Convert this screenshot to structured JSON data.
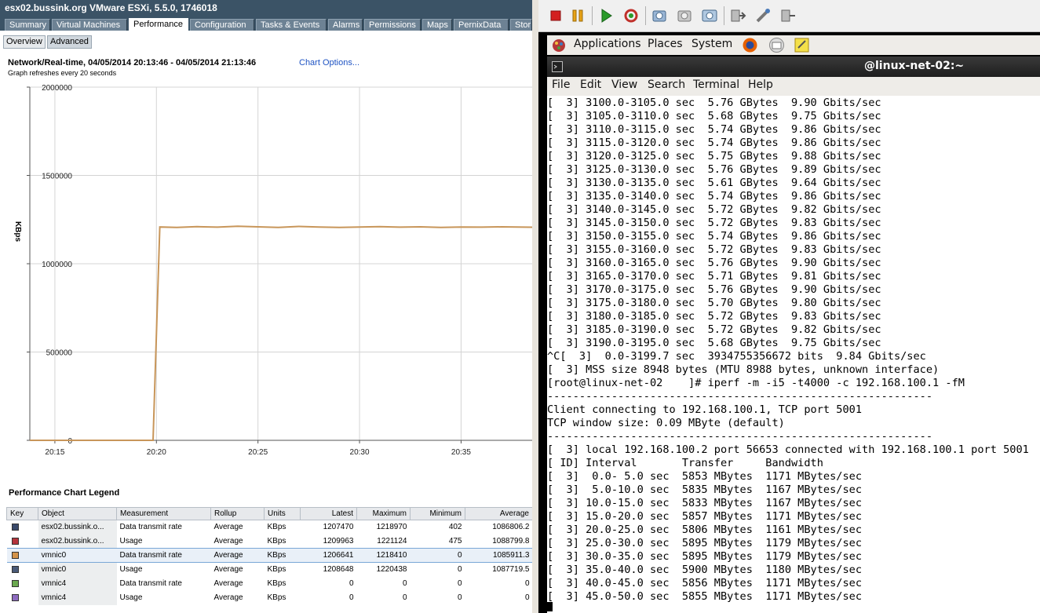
{
  "vsphere": {
    "title": "esx02.bussink.org VMware ESXi, 5.5.0, 1746018",
    "tabs": [
      {
        "label": "Summary"
      },
      {
        "label": "Virtual Machines"
      },
      {
        "label": "Performance"
      },
      {
        "label": "Configuration"
      },
      {
        "label": "Tasks & Events"
      },
      {
        "label": "Alarms"
      },
      {
        "label": "Permissions"
      },
      {
        "label": "Maps"
      },
      {
        "label": "PernixData"
      },
      {
        "label": "Stor"
      }
    ],
    "active_tab": "Performance",
    "subtabs": [
      {
        "label": "Overview"
      },
      {
        "label": "Advanced"
      }
    ],
    "active_subtab": "Advanced",
    "chart_title": "Network/Real-time, 04/05/2014 20:13:46 - 04/05/2014 21:13:46",
    "chart_options_link": "Chart Options...",
    "refresh_note": "Graph refreshes every 20 seconds",
    "legend_title": "Performance Chart Legend",
    "legend_columns": [
      "Key",
      "Object",
      "Measurement",
      "Rollup",
      "Units",
      "Latest",
      "Maximum",
      "Minimum",
      "Average"
    ],
    "legend_rows": [
      {
        "color": "#3a4a6b",
        "object": "esx02.bussink.o...",
        "measurement": "Data transmit rate",
        "rollup": "Average",
        "units": "KBps",
        "latest": "1207470",
        "maximum": "1218970",
        "minimum": "402",
        "average": "1086806.2"
      },
      {
        "color": "#b5343c",
        "object": "esx02.bussink.o...",
        "measurement": "Usage",
        "rollup": "Average",
        "units": "KBps",
        "latest": "1209963",
        "maximum": "1221124",
        "minimum": "475",
        "average": "1088799.8"
      },
      {
        "color": "#d4934a",
        "object": "vmnic0",
        "measurement": "Data transmit rate",
        "rollup": "Average",
        "units": "KBps",
        "latest": "1206641",
        "maximum": "1218410",
        "minimum": "0",
        "average": "1085911.3",
        "selected": true
      },
      {
        "color": "#4a5a78",
        "object": "vmnic0",
        "measurement": "Usage",
        "rollup": "Average",
        "units": "KBps",
        "latest": "1208648",
        "maximum": "1220438",
        "minimum": "0",
        "average": "1087719.5"
      },
      {
        "color": "#6aa84f",
        "object": "vmnic4",
        "measurement": "Data transmit rate",
        "rollup": "Average",
        "units": "KBps",
        "latest": "0",
        "maximum": "0",
        "minimum": "0",
        "average": "0"
      },
      {
        "color": "#8e6cc0",
        "object": "vmnic4",
        "measurement": "Usage",
        "rollup": "Average",
        "units": "KBps",
        "latest": "0",
        "maximum": "0",
        "minimum": "0",
        "average": "0"
      }
    ]
  },
  "chart_data": {
    "type": "line",
    "title": "Network/Real-time, 04/05/2014 20:13:46 - 04/05/2014 21:13:46",
    "xlabel": "",
    "ylabel": "KBps",
    "ylim": [
      0,
      2000000
    ],
    "yticks": [
      "2000000",
      "1500000",
      "1000000",
      "500000",
      "0"
    ],
    "xticks": [
      "20:15",
      "20:20",
      "20:25",
      "20:30",
      "20:35"
    ],
    "xlim": [
      "20:13:46",
      "20:38:30"
    ],
    "grid": true,
    "series": [
      {
        "name": "vmnic0 Data transmit rate",
        "color": "#c8965a",
        "x": [
          "20:13:46",
          "20:19:50",
          "20:20:10",
          "20:21:00",
          "20:22:00",
          "20:23:00",
          "20:24:00",
          "20:25:00",
          "20:26:00",
          "20:27:00",
          "20:28:00",
          "20:29:00",
          "20:30:00",
          "20:31:00",
          "20:32:00",
          "20:33:00",
          "20:34:00",
          "20:35:00",
          "20:36:00",
          "20:37:00",
          "20:38:30"
        ],
        "values": [
          0,
          0,
          1208000,
          1206000,
          1210000,
          1207000,
          1212000,
          1209000,
          1206000,
          1211000,
          1208000,
          1206000,
          1208000,
          1210000,
          1207000,
          1209000,
          1206000,
          1208000,
          1207000,
          1209000,
          1206641
        ]
      }
    ]
  },
  "console": {
    "toolbar_icons": [
      "stop-icon",
      "pause-icon",
      "play-icon",
      "reset-icon",
      "snapshot-icon",
      "revert-icon",
      "manage-snapshots-icon",
      "connect-cd-icon",
      "connect-floppy-icon",
      "connect-device-icon"
    ],
    "panel_menus": [
      "Applications",
      "Places",
      "System"
    ],
    "terminal_title": "@linux-net-02:~",
    "terminal_menus": [
      "File",
      "Edit",
      "View",
      "Search",
      "Terminal",
      "Help"
    ],
    "lines": [
      "[  3] 3100.0-3105.0 sec  5.76 GBytes  9.90 Gbits/sec",
      "[  3] 3105.0-3110.0 sec  5.68 GBytes  9.75 Gbits/sec",
      "[  3] 3110.0-3115.0 sec  5.74 GBytes  9.86 Gbits/sec",
      "[  3] 3115.0-3120.0 sec  5.74 GBytes  9.86 Gbits/sec",
      "[  3] 3120.0-3125.0 sec  5.75 GBytes  9.88 Gbits/sec",
      "[  3] 3125.0-3130.0 sec  5.76 GBytes  9.89 Gbits/sec",
      "[  3] 3130.0-3135.0 sec  5.61 GBytes  9.64 Gbits/sec",
      "[  3] 3135.0-3140.0 sec  5.74 GBytes  9.86 Gbits/sec",
      "[  3] 3140.0-3145.0 sec  5.72 GBytes  9.82 Gbits/sec",
      "[  3] 3145.0-3150.0 sec  5.72 GBytes  9.83 Gbits/sec",
      "[  3] 3150.0-3155.0 sec  5.74 GBytes  9.86 Gbits/sec",
      "[  3] 3155.0-3160.0 sec  5.72 GBytes  9.83 Gbits/sec",
      "[  3] 3160.0-3165.0 sec  5.76 GBytes  9.90 Gbits/sec",
      "[  3] 3165.0-3170.0 sec  5.71 GBytes  9.81 Gbits/sec",
      "[  3] 3170.0-3175.0 sec  5.76 GBytes  9.90 Gbits/sec",
      "[  3] 3175.0-3180.0 sec  5.70 GBytes  9.80 Gbits/sec",
      "[  3] 3180.0-3185.0 sec  5.72 GBytes  9.83 Gbits/sec",
      "[  3] 3185.0-3190.0 sec  5.72 GBytes  9.82 Gbits/sec",
      "[  3] 3190.0-3195.0 sec  5.68 GBytes  9.75 Gbits/sec",
      "^C[  3]  0.0-3199.7 sec  3934755356672 bits  9.84 Gbits/sec",
      "[  3] MSS size 8948 bytes (MTU 8988 bytes, unknown interface)",
      "[root@linux-net-02    ]# iperf -m -i5 -t4000 -c 192.168.100.1 -fM",
      "------------------------------------------------------------",
      "Client connecting to 192.168.100.1, TCP port 5001",
      "TCP window size: 0.09 MByte (default)",
      "------------------------------------------------------------",
      "[  3] local 192.168.100.2 port 56653 connected with 192.168.100.1 port 5001",
      "[ ID] Interval       Transfer     Bandwidth",
      "[  3]  0.0- 5.0 sec  5853 MBytes  1171 MBytes/sec",
      "[  3]  5.0-10.0 sec  5835 MBytes  1167 MBytes/sec",
      "[  3] 10.0-15.0 sec  5833 MBytes  1167 MBytes/sec",
      "[  3] 15.0-20.0 sec  5857 MBytes  1171 MBytes/sec",
      "[  3] 20.0-25.0 sec  5806 MBytes  1161 MBytes/sec",
      "[  3] 25.0-30.0 sec  5895 MBytes  1179 MBytes/sec",
      "[  3] 30.0-35.0 sec  5895 MBytes  1179 MBytes/sec",
      "[  3] 35.0-40.0 sec  5900 MBytes  1180 MBytes/sec",
      "[  3] 40.0-45.0 sec  5856 MBytes  1171 MBytes/sec",
      "[  3] 45.0-50.0 sec  5855 MBytes  1171 MBytes/sec"
    ]
  }
}
